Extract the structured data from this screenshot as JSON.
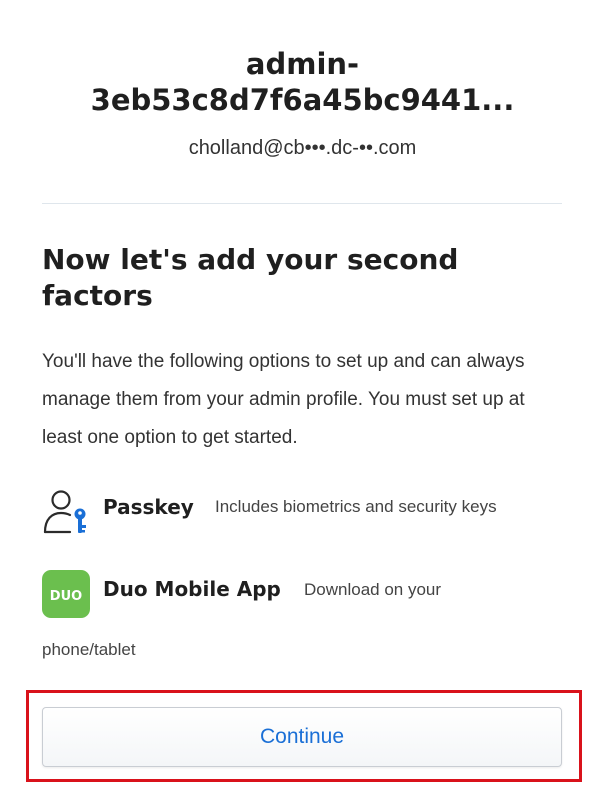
{
  "account": {
    "name": "admin-3eb53c8d7f6a45bc9441...",
    "email": "cholland@cb•••.dc-••.com"
  },
  "setup": {
    "heading": "Now let's add your second factors",
    "intro": "You'll have the following options to set up and can always manage them from your admin profile. You must set up at least one option to get started."
  },
  "options": [
    {
      "icon": "passkey-icon",
      "title": "Passkey",
      "description": "Includes biometrics and security keys"
    },
    {
      "icon": "duo-mobile-icon",
      "title": "Duo Mobile App",
      "description": "Download on your",
      "description_wrap": "phone/tablet"
    }
  ],
  "actions": {
    "continue_label": "Continue"
  },
  "colors": {
    "accent": "#1a6fd6",
    "duo_green": "#6bbf4e",
    "highlight": "#d9121b",
    "passkey_key": "#1a6fd6"
  }
}
